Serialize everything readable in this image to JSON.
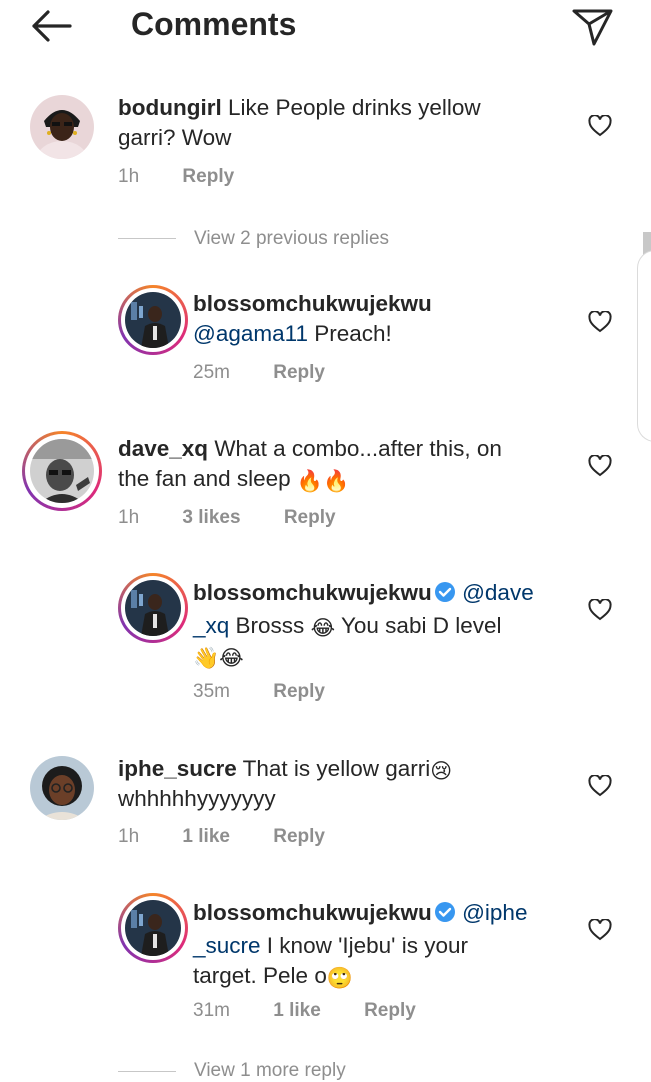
{
  "header": {
    "title": "Comments",
    "back_icon": "back-arrow-icon",
    "send_icon": "paper-plane-icon"
  },
  "comments": [
    {
      "username": "bodungirl",
      "text_line1": " Like People drinks yellow",
      "text_line2": "garri? Wow",
      "time": "1h",
      "reply": "Reply"
    },
    {
      "view_replies": "View 2 previous replies"
    },
    {
      "username": "blossomchukwujekwu",
      "mention": "@agama11",
      "text": " Preach!",
      "time": "25m",
      "reply": "Reply"
    },
    {
      "username": "dave_xq",
      "text_line1": " What a combo...after this, on",
      "text_line2": "the fan and sleep ",
      "emoji": "🔥🔥",
      "time": "1h",
      "likes": "3 likes",
      "reply": "Reply"
    },
    {
      "username": "blossomchukwujekwu",
      "mention_part1": "@dave",
      "mention_part2": "_xq",
      "text_a": " Brosss ",
      "emoji_a": "😂",
      "text_b": " You sabi D level",
      "emoji_b": "👋😂",
      "time": "35m",
      "reply": "Reply"
    },
    {
      "username": "iphe_sucre",
      "text_line1": " That is yellow garri",
      "emoji": "😢",
      "text_line2": "whhhhhyyyyyyy",
      "time": "1h",
      "likes": "1 like",
      "reply": "Reply"
    },
    {
      "username": "blossomchukwujekwu",
      "mention_part1": "@iphe",
      "mention_part2": "_sucre",
      "text_line2": " I know 'Ijebu' is your",
      "text_line3": "target.  Pele o",
      "emoji": "🙄",
      "time": "31m",
      "likes": "1 like",
      "reply": "Reply"
    },
    {
      "view_replies": "View 1 more reply"
    }
  ],
  "colors": {
    "text": "#262626",
    "secondary": "#8e8e8e",
    "mention": "#00376b",
    "verified": "#3897f0"
  }
}
